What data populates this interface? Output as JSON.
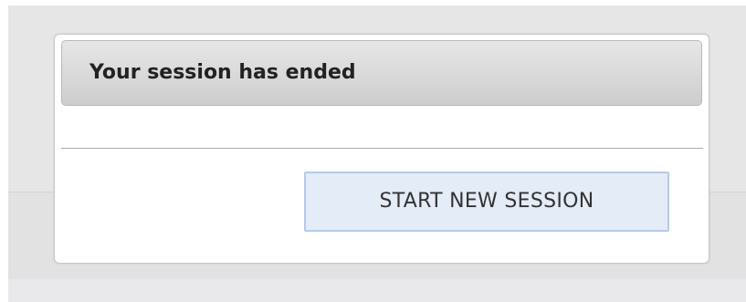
{
  "dialog": {
    "title": "Your session has ended",
    "primary_button_label": "START NEW SESSION"
  },
  "colors": {
    "backdrop": "#e6e6e6",
    "header_gradient_top": "#e6e6e6",
    "header_gradient_bottom": "#cdcdcd",
    "button_background": "#e4ecf7",
    "button_border": "#b4cbeb",
    "title_text": "#222222"
  }
}
